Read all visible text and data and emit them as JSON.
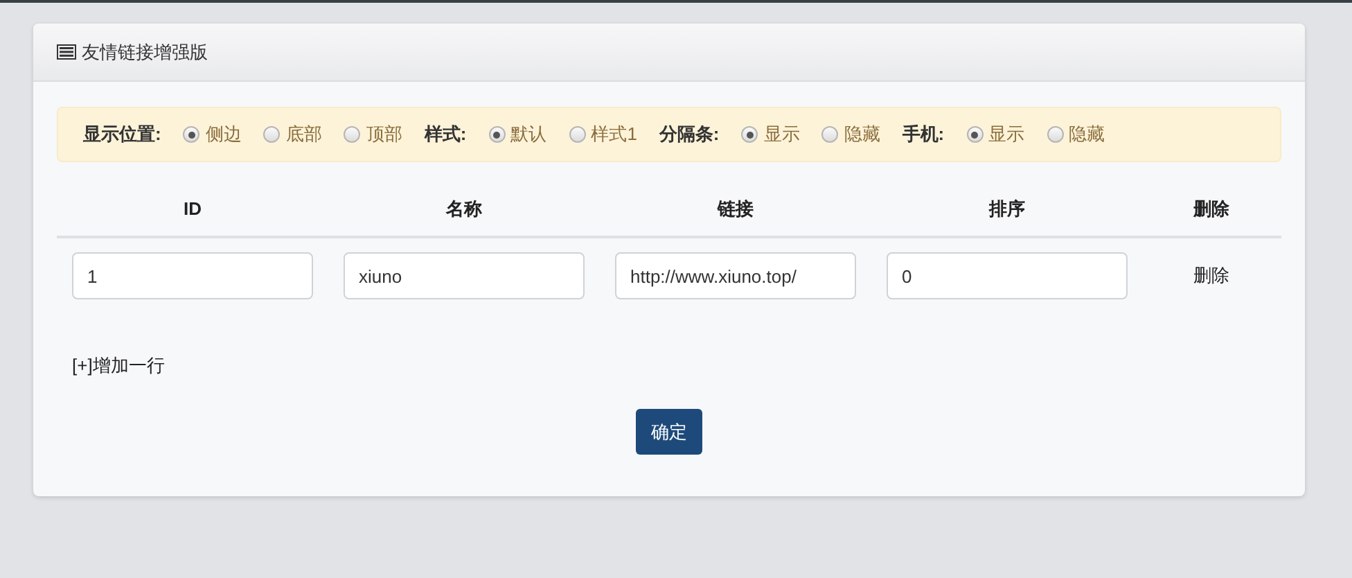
{
  "panel": {
    "title": "友情链接增强版"
  },
  "option_groups": [
    {
      "label": "显示位置:",
      "options": [
        {
          "label": "侧边",
          "selected": true
        },
        {
          "label": "底部",
          "selected": false
        },
        {
          "label": "顶部",
          "selected": false
        }
      ]
    },
    {
      "label": "样式:",
      "options": [
        {
          "label": "默认",
          "selected": true
        },
        {
          "label": "样式1",
          "selected": false
        }
      ]
    },
    {
      "label": "分隔条:",
      "options": [
        {
          "label": "显示",
          "selected": true
        },
        {
          "label": "隐藏",
          "selected": false
        }
      ]
    },
    {
      "label": "手机:",
      "options": [
        {
          "label": "显示",
          "selected": true
        },
        {
          "label": "隐藏",
          "selected": false
        }
      ]
    }
  ],
  "table": {
    "columns": [
      "ID",
      "名称",
      "链接",
      "排序",
      "删除"
    ],
    "rows": [
      {
        "fields": [
          "1",
          "xiuno",
          "http://www.xiuno.top/",
          "0"
        ],
        "delete": "删除"
      }
    ]
  },
  "add_row": "[+]增加一行",
  "submit": "确定"
}
